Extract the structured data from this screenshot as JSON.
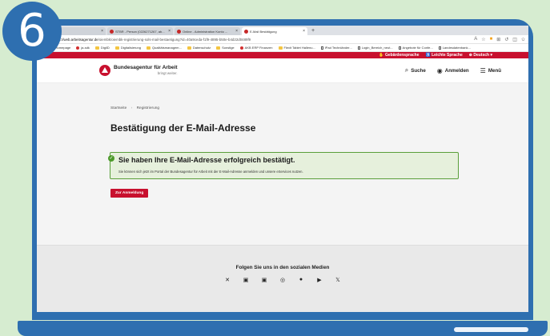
{
  "step_number": "6",
  "browser": {
    "tabs": [
      {
        "label": "ldung",
        "active": false
      },
      {
        "label": "STBR - Person (0226271267, ab...",
        "active": false
      },
      {
        "label": "Online - Administration Konto ...",
        "active": false
      },
      {
        "label": "E-Mail Bestätigung",
        "active": true
      }
    ],
    "new_tab": "+",
    "url_host": "https://web.arbeitsagentur.de",
    "url_path": "/oiembk/oiembk-registrierung-sols-mail-bestaetigung?id=40a9ceda-f1f9-4895-b50e-b4d22d0489f9",
    "bookmarks": [
      {
        "label": "ter",
        "icon": "folder"
      },
      {
        "label": "Homepage",
        "icon": "folder"
      },
      {
        "label": "ja-sdk",
        "icon": "red-dot"
      },
      {
        "label": "DigiID",
        "icon": "folder"
      },
      {
        "label": "Digitalisierung",
        "icon": "folder"
      },
      {
        "label": "Qualitätsmanagem...",
        "icon": "folder"
      },
      {
        "label": "Datenschutz",
        "icon": "folder"
      },
      {
        "label": "Sonstige",
        "icon": "folder"
      },
      {
        "label": "AKB ERP Finanzen",
        "icon": "red-dot"
      },
      {
        "label": "Flexit Tablet Hallenu...",
        "icon": "folder"
      },
      {
        "label": "iPad Techniänder...",
        "icon": "doc"
      },
      {
        "label": "Login_Bereich_neut...",
        "icon": "doc"
      },
      {
        "label": "Angebote für Confe...",
        "icon": "doc"
      },
      {
        "label": "Landesdatenbank...",
        "icon": "doc"
      }
    ]
  },
  "topbar": {
    "sign_language": "Gebärdensprache",
    "easy_language": "Leichte Sprache",
    "language": "Deutsch"
  },
  "header": {
    "logo_name": "Bundesagentur für Arbeit",
    "logo_tagline": "bringt weiter.",
    "search": "Suche",
    "login": "Anmelden",
    "menu": "Menü"
  },
  "breadcrumb": {
    "home": "Startseite",
    "separator": "›",
    "current": "Registrierung"
  },
  "page_title": "Bestätigung der E-Mail-Adresse",
  "success": {
    "title": "Sie haben Ihre E-Mail-Adresse erfolgreich bestätigt.",
    "text": "Sie können sich jetzt im Portal der Bundesagentur für Arbeit mit der E-Mail-Adresse anmelden und unsere eServices nutzen."
  },
  "cta_label": "Zur Anmeldung",
  "footer": {
    "title": "Folgen Sie uns in den sozialen Medien",
    "socials": [
      "xing",
      "linkedin",
      "linkedin-alt",
      "instagram",
      "facebook",
      "youtube",
      "x"
    ]
  },
  "colors": {
    "brand_red": "#c8102e",
    "laptop_blue": "#2e6fb0",
    "success_green": "#4c9a2a",
    "background_green": "#d6ecd0"
  }
}
